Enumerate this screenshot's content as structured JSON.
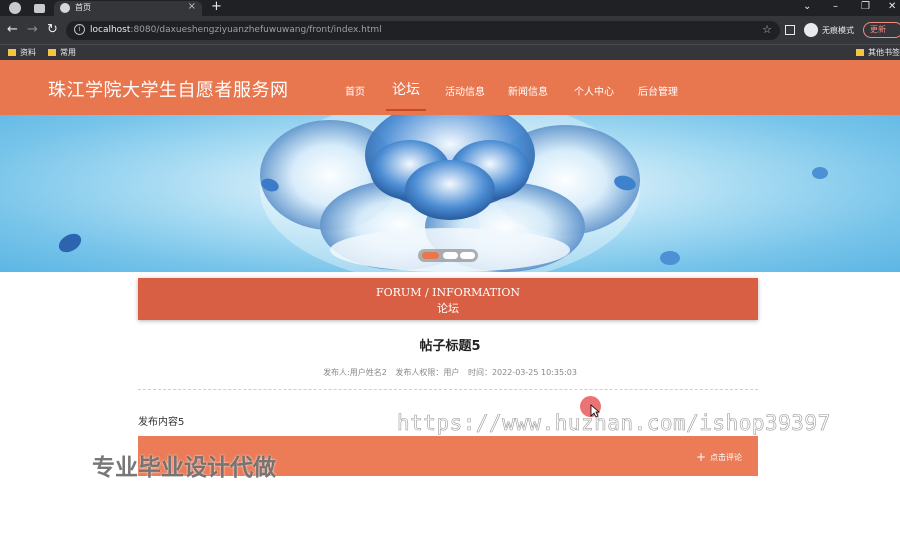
{
  "browser": {
    "tab_title": "首页",
    "url_host": "localhost",
    "url_rest": ":8080/daxueshengziyuanzhefuwuwang/front/index.html",
    "incognito_label": "无痕模式",
    "update_label": "更新",
    "bookmarks": [
      "资料",
      "常用",
      "其他书签"
    ]
  },
  "site": {
    "title": "珠江学院大学生自愿者服务网",
    "nav": [
      {
        "label": "首页"
      },
      {
        "label": "论坛"
      },
      {
        "label": "活动信息"
      },
      {
        "label": "新闻信息"
      },
      {
        "label": "个人中心"
      },
      {
        "label": "后台管理"
      }
    ],
    "active_nav": "论坛"
  },
  "banner": {
    "active_slide": 1,
    "slide_count": 3
  },
  "section": {
    "title_en": "FORUM / INFORMATION",
    "title_cn": "论坛"
  },
  "post": {
    "title": "帖子标题5",
    "author": "发布人:用户姓名2",
    "permission": "发布人权限：用户",
    "time": "时间：2022-03-25 10:35:03",
    "content": "发布内容5"
  },
  "comment": {
    "button_label": "点击评论"
  },
  "overlay": {
    "url_watermark": "https://www.huzhan.com/ishop39397",
    "cn_watermark": "专业毕业设计代做"
  },
  "colors": {
    "header": "#e8764f",
    "section_bar": "#d85f44",
    "comment_bar": "#ec7b58"
  }
}
